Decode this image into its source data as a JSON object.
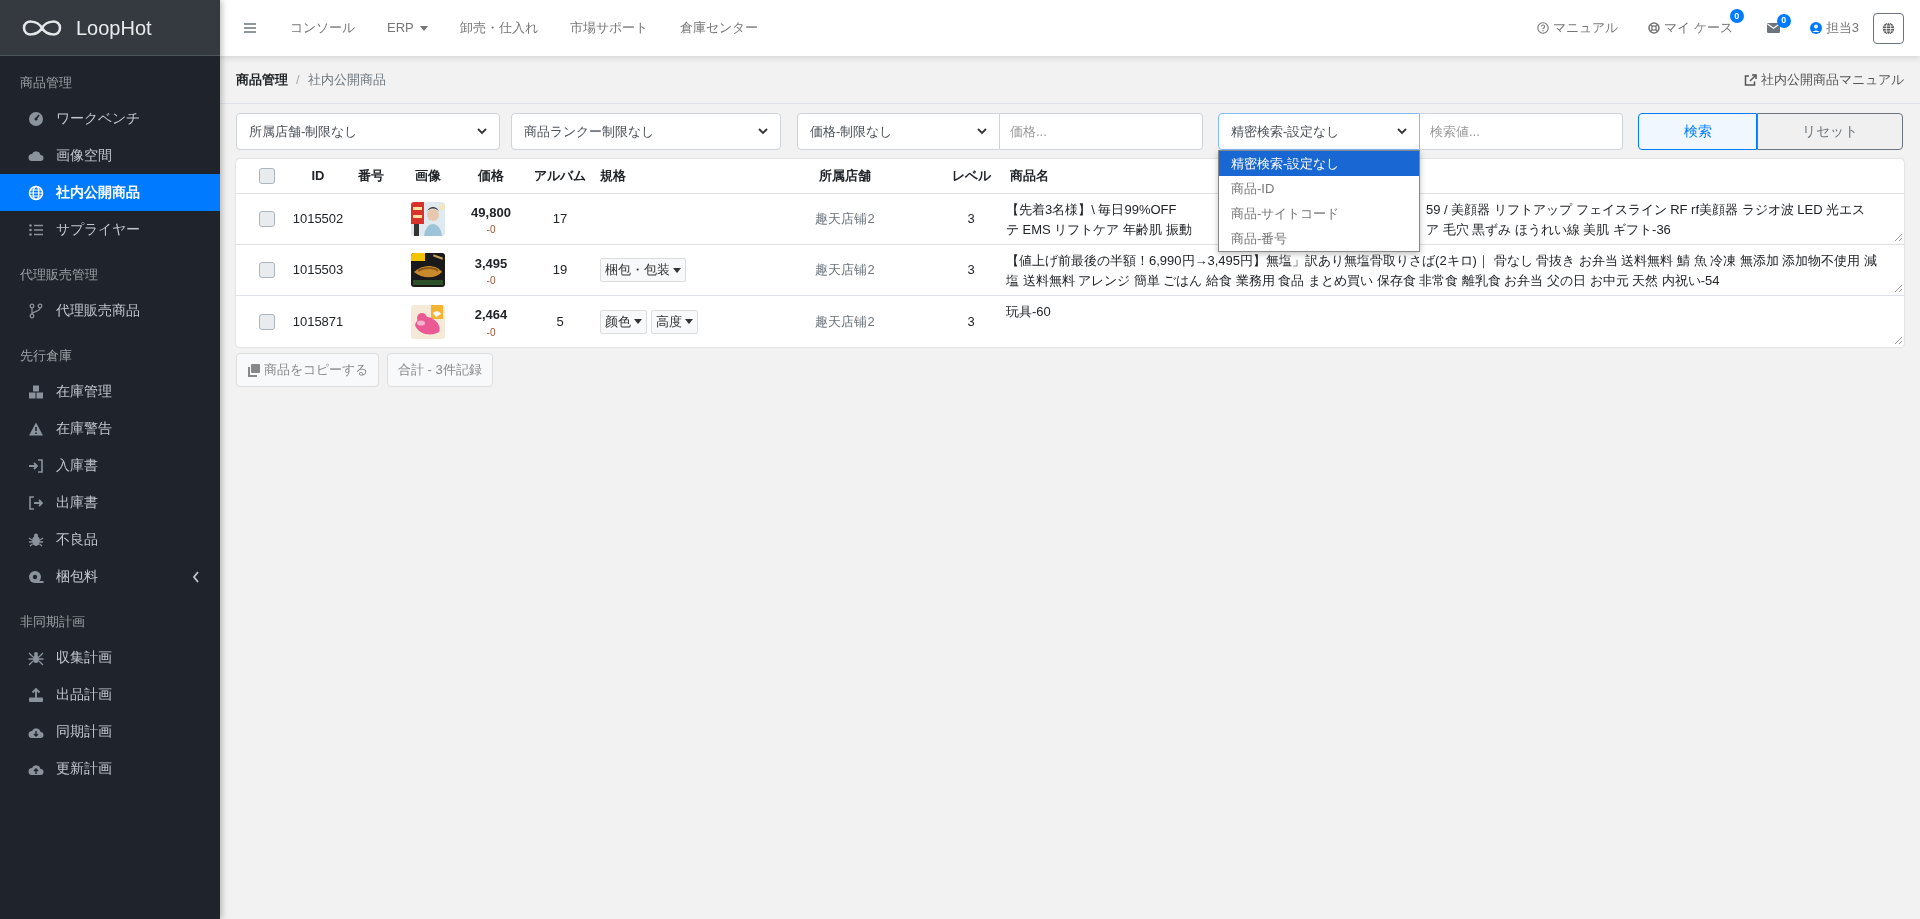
{
  "brand": {
    "name": "LoopHot"
  },
  "sidebar": [
    {
      "title": "商品管理",
      "items": [
        {
          "label": "ワークベンチ",
          "kind": "link",
          "selected": false
        },
        {
          "label": "画像空間",
          "kind": "link",
          "selected": false
        },
        {
          "label": "社内公開商品",
          "kind": "link",
          "selected": true
        },
        {
          "label": "サプライヤー",
          "kind": "link",
          "selected": false
        }
      ]
    },
    {
      "title": "代理販売管理",
      "items": [
        {
          "label": "代理販売商品",
          "kind": "link",
          "selected": false
        }
      ]
    },
    {
      "title": "先行倉庫",
      "items": [
        {
          "label": "在庫管理",
          "kind": "link",
          "selected": false
        },
        {
          "label": "在庫警告",
          "kind": "link",
          "selected": false
        },
        {
          "label": "入庫書",
          "kind": "link",
          "selected": false
        },
        {
          "label": "出庫書",
          "kind": "link",
          "selected": false
        },
        {
          "label": "不良品",
          "kind": "link",
          "selected": false
        },
        {
          "label": "梱包料",
          "kind": "submenu",
          "expanded": false,
          "selected": false
        }
      ]
    },
    {
      "title": "非同期計画",
      "items": [
        {
          "label": "収集計画",
          "kind": "link",
          "selected": false
        },
        {
          "label": "出品計画",
          "kind": "link",
          "selected": false
        },
        {
          "label": "同期計画",
          "kind": "link",
          "selected": false
        },
        {
          "label": "更新計画",
          "kind": "link",
          "selected": false
        }
      ]
    }
  ],
  "topbar": {
    "links": [
      {
        "label": "コンソール",
        "kind": "link"
      },
      {
        "label": "ERP",
        "kind": "dropdown"
      },
      {
        "label": "卸売・仕入れ",
        "kind": "link"
      },
      {
        "label": "市場サポート",
        "kind": "link"
      },
      {
        "label": "倉庫センター",
        "kind": "link"
      }
    ],
    "right": [
      {
        "kind": "help",
        "label": "マニュアル"
      },
      {
        "kind": "support",
        "label": "マイ ケース",
        "badge": "0"
      },
      {
        "kind": "mail",
        "badge": "0"
      },
      {
        "kind": "user",
        "label": "担当3"
      },
      {
        "kind": "language"
      }
    ]
  },
  "breadcrumb": [
    {
      "label": "商品管理",
      "selected": false
    },
    {
      "label": "社内公開商品",
      "selected": true
    }
  ],
  "breadcrumb_separator": "/",
  "manual_link": "社内公開商品マニュアル",
  "filters": [
    [
      {
        "kind": "select",
        "value": "所属店舗-制限なし",
        "expanded": false
      }
    ],
    [
      {
        "kind": "select",
        "value": "商品ランクー制限なし",
        "expanded": false
      }
    ],
    [
      {
        "kind": "select",
        "value": "価格-制限なし",
        "expanded": false
      },
      {
        "kind": "input",
        "placeholder": "価格..."
      }
    ],
    [
      {
        "kind": "select",
        "value": "精密検索-設定なし",
        "expanded": true,
        "options": [
          {
            "label": "精密検索-設定なし",
            "selected": true
          },
          {
            "label": "商品-ID",
            "selected": false
          },
          {
            "label": "商品-サイトコード",
            "selected": false
          },
          {
            "label": "商品-番号",
            "selected": false
          }
        ]
      },
      {
        "kind": "input",
        "placeholder": "検索値..."
      }
    ]
  ],
  "buttons": [
    {
      "label": "検索",
      "kind": "primary"
    },
    {
      "label": "リセット",
      "kind": "secondary"
    }
  ],
  "table": {
    "header_checked": false,
    "columns": [
      "ID",
      "番号",
      "画像",
      "価格",
      "アルバム",
      "規格",
      "所属店舗",
      "レベル",
      "商品名"
    ],
    "rows": [
      {
        "checked": false,
        "id": "1015502",
        "price": "49,800",
        "price_change": "-0",
        "album": "17",
        "store": "趣天店铺2",
        "rank": "3",
        "name_lines": [
          [
            "【先着3名様】\\ 毎日99%OFF",
            "59 / 美顔器 リフトアップ フェイスライン RF rf美顔器 ラジオ波 LED 光エス"
          ],
          [
            "テ EMS リフトケア 年齢肌 振動",
            "ア 毛穴 黒ずみ ほうれい線 美肌 ギフト-36"
          ]
        ]
      },
      {
        "checked": false,
        "id": "1015503",
        "price": "3,495",
        "price_change": "-0",
        "album": "19",
        "specs": [
          "梱包・包装"
        ],
        "store": "趣天店铺2",
        "rank": "3",
        "name": "【値上げ前最後の半額！6,990円→3,495円】無塩」訳あり無塩骨取りさば(2キロ)｜ 骨なし 骨抜き お弁当 送料無料 鯖 魚 冷凍 無添加 添加物不使用 減塩 送料無料 アレンジ 簡単 ごはん 給食 業務用 食品 まとめ買い 保存食 非常食 離乳食 お弁当 父の日 お中元 天然 内祝い-54"
      },
      {
        "checked": false,
        "id": "1015871",
        "price": "2,464",
        "price_change": "-0",
        "album": "5",
        "specs": [
          "颜色",
          "高度"
        ],
        "store": "趣天店铺2",
        "rank": "3",
        "name": "玩具-60"
      }
    ]
  },
  "footer_buttons": [
    {
      "label": "商品をコピーする",
      "kind": "copy"
    },
    {
      "label": "合計 - 3件記録",
      "kind": "total"
    }
  ]
}
